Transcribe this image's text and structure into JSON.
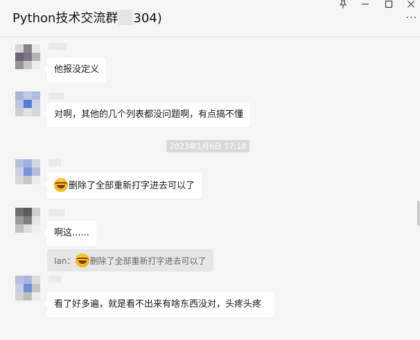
{
  "window": {
    "title": "Python技术交流群",
    "title_suffix": "304)",
    "pin_icon": "pin-icon",
    "minimize_icon": "minimize-icon",
    "maximize_icon": "maximize-icon",
    "close_icon": "close-icon",
    "more_icon": "more-icon"
  },
  "messages": [
    {
      "text": "他报没定义"
    },
    {
      "text": "对啊，其他的几个列表都没问题啊，有点搞不懂"
    },
    {
      "text": "删除了全部重新打字进去可以了",
      "emoji": "grin-sweat-emoji"
    },
    {
      "text": "啊这......"
    },
    {
      "text": "看了好多遍，就是看不出来有啥东西没对，头疼头疼"
    }
  ],
  "timestamp": "2023年1月6日 17:18",
  "quote": {
    "prefix": "Ian：",
    "text": "删除了全部重新打字进去可以了",
    "emoji": "grin-sweat-emoji"
  },
  "colors": {
    "background": "#f5f5f5",
    "bubble": "#ffffff",
    "timestamp_bg": "#dadada",
    "quote_bg": "#e6e6e6"
  }
}
